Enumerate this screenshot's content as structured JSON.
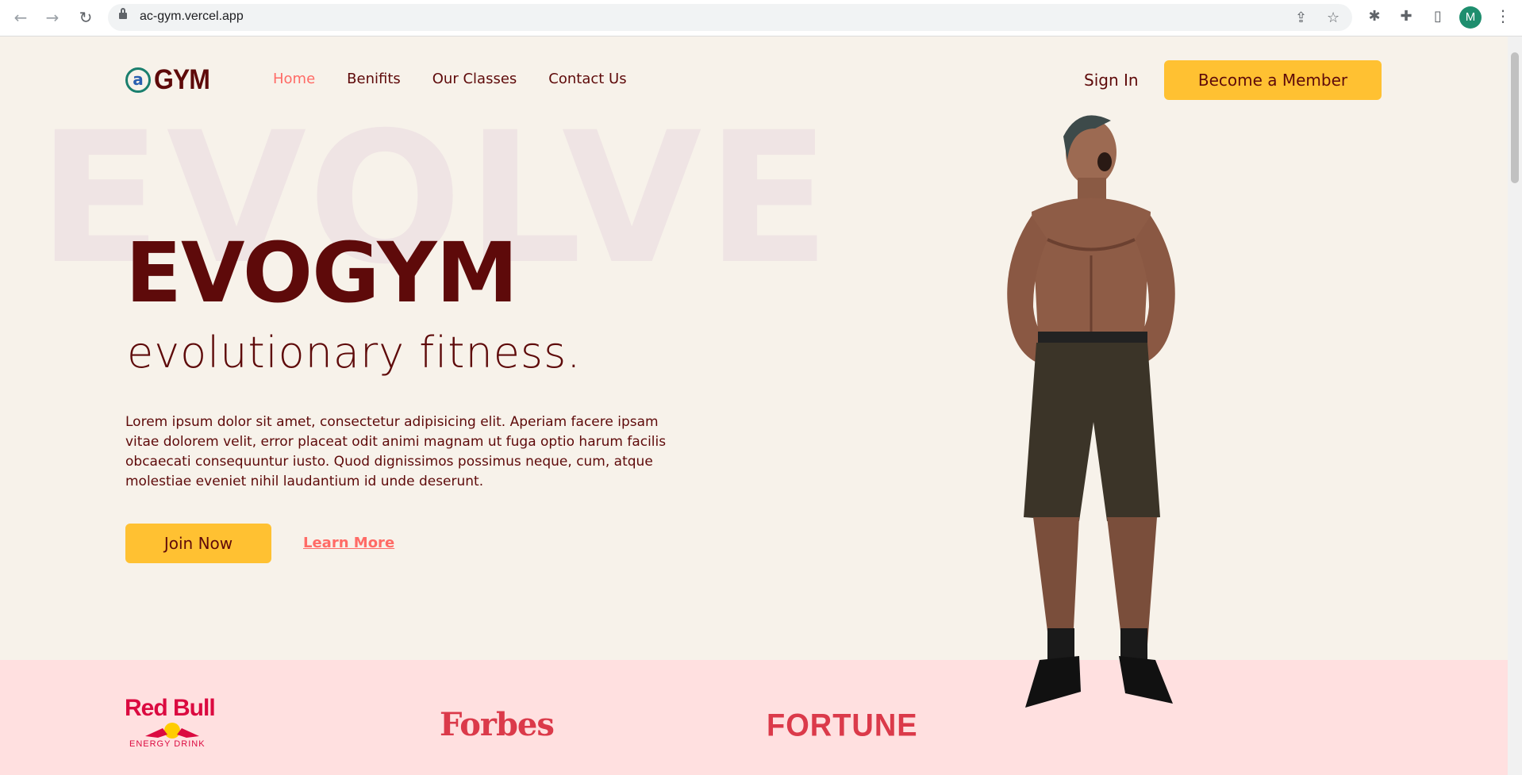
{
  "browser": {
    "url": "ac-gym.vercel.app",
    "avatar_initial": "M"
  },
  "logo": {
    "mark": "a",
    "text": "GYM"
  },
  "nav": {
    "items": [
      {
        "label": "Home",
        "active": true
      },
      {
        "label": "Benifits",
        "active": false
      },
      {
        "label": "Our Classes",
        "active": false
      },
      {
        "label": "Contact Us",
        "active": false
      }
    ],
    "sign_in": "Sign In",
    "cta": "Become a Member"
  },
  "hero": {
    "background_word": "EVOLVE",
    "title": "EVOGYM",
    "subtitle": "evolutionary fitness.",
    "description": "Lorem ipsum dolor sit amet, consectetur adipisicing elit. Aperiam facere ipsam vitae dolorem velit, error placeat odit animi magnam ut fuga optio harum facilis obcaecati consequuntur iusto. Quod dignissimos possimus neque, cum, atque molestiae eveniet nihil laudantium id unde deserunt.",
    "join_label": "Join Now",
    "learn_more_label": "Learn More"
  },
  "sponsors": {
    "redbull": "Red Bull",
    "redbull_sub": "ENERGY DRINK",
    "forbes": "Forbes",
    "fortune": "FORTUNE"
  },
  "colors": {
    "background": "#f7f2ea",
    "primary_text": "#5e0a0a",
    "accent": "#ff6b66",
    "cta": "#ffc132",
    "sponsor_band": "#ffe0e0"
  }
}
